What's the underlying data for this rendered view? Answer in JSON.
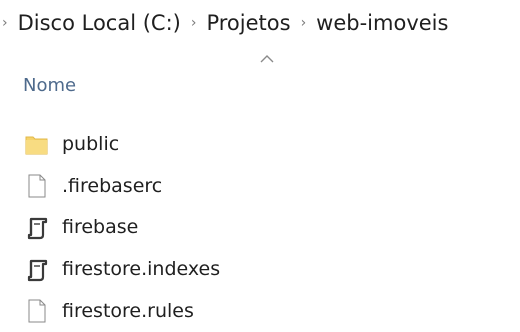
{
  "breadcrumb": {
    "items": [
      {
        "label": "Disco Local (C:)"
      },
      {
        "label": "Projetos"
      },
      {
        "label": "web-imoveis"
      }
    ]
  },
  "column_header": {
    "label": "Nome",
    "sort": "ascending"
  },
  "files": [
    {
      "name": "public",
      "icon": "folder-icon"
    },
    {
      "name": ".firebaserc",
      "icon": "document-icon"
    },
    {
      "name": "firebase",
      "icon": "script-file-icon"
    },
    {
      "name": "firestore.indexes",
      "icon": "script-file-icon"
    },
    {
      "name": "firestore.rules",
      "icon": "document-icon"
    }
  ],
  "colors": {
    "header_text": "#4e6a8c",
    "folder": "#f6d36b",
    "separator": "#7a7a7a"
  }
}
